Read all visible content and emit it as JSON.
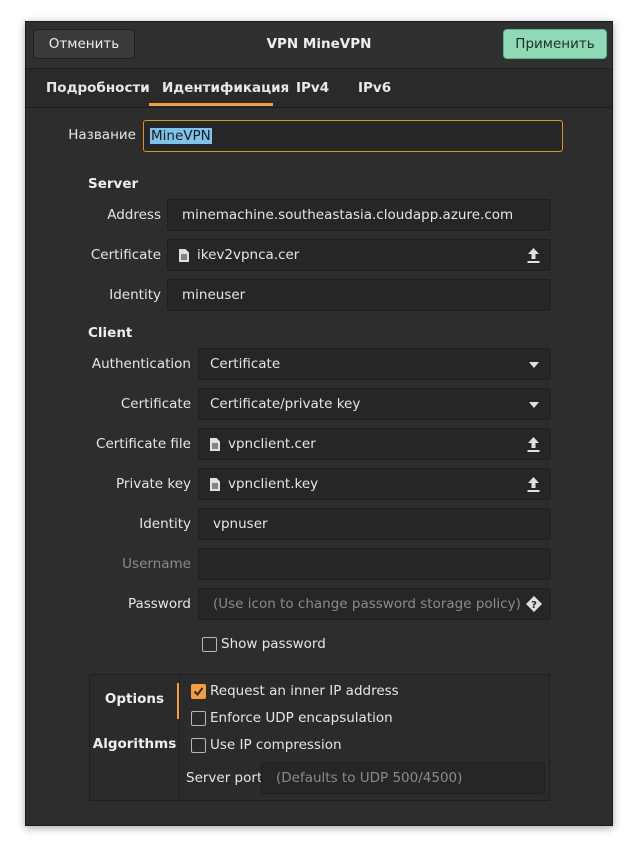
{
  "window": {
    "title": "VPN MineVPN",
    "cancel_label": "Отменить",
    "apply_label": "Применить"
  },
  "tabs": [
    {
      "label": "Подробности",
      "active": false
    },
    {
      "label": "Идентификация",
      "active": true
    },
    {
      "label": "IPv4",
      "active": false
    },
    {
      "label": "IPv6",
      "active": false
    }
  ],
  "name": {
    "label": "Название",
    "value": "MineVPN"
  },
  "server": {
    "section": "Server",
    "address_label": "Address",
    "address_value": "minemachine.southeastasia.cloudapp.azure.com",
    "certificate_label": "Certificate",
    "certificate_value": "ikev2vpnca.cer",
    "identity_label": "Identity",
    "identity_value": "mineuser"
  },
  "client": {
    "section": "Client",
    "auth_label": "Authentication",
    "auth_value": "Certificate",
    "cert_label": "Certificate",
    "cert_value": "Certificate/private key",
    "cert_file_label": "Certificate file",
    "cert_file_value": "vpnclient.cer",
    "private_key_label": "Private key",
    "private_key_value": "vpnclient.key",
    "identity_label": "Identity",
    "identity_value": "vpnuser",
    "username_label": "Username",
    "password_label": "Password",
    "password_placeholder": "(Use icon to change password storage policy)",
    "show_password_label": "Show password",
    "show_password_checked": false
  },
  "options": {
    "side_items": [
      "Options",
      "Algorithms"
    ],
    "active_side": "Options",
    "request_ip_label": "Request an inner IP address",
    "request_ip_checked": true,
    "enforce_udp_label": "Enforce UDP encapsulation",
    "enforce_udp_checked": false,
    "ip_compression_label": "Use IP compression",
    "ip_compression_checked": false,
    "server_port_label": "Server port",
    "server_port_placeholder": "(Defaults to UDP 500/4500)"
  },
  "colors": {
    "accent": "#f0a040",
    "apply_button": "#8fd9b6",
    "background": "#2d2d2d"
  }
}
